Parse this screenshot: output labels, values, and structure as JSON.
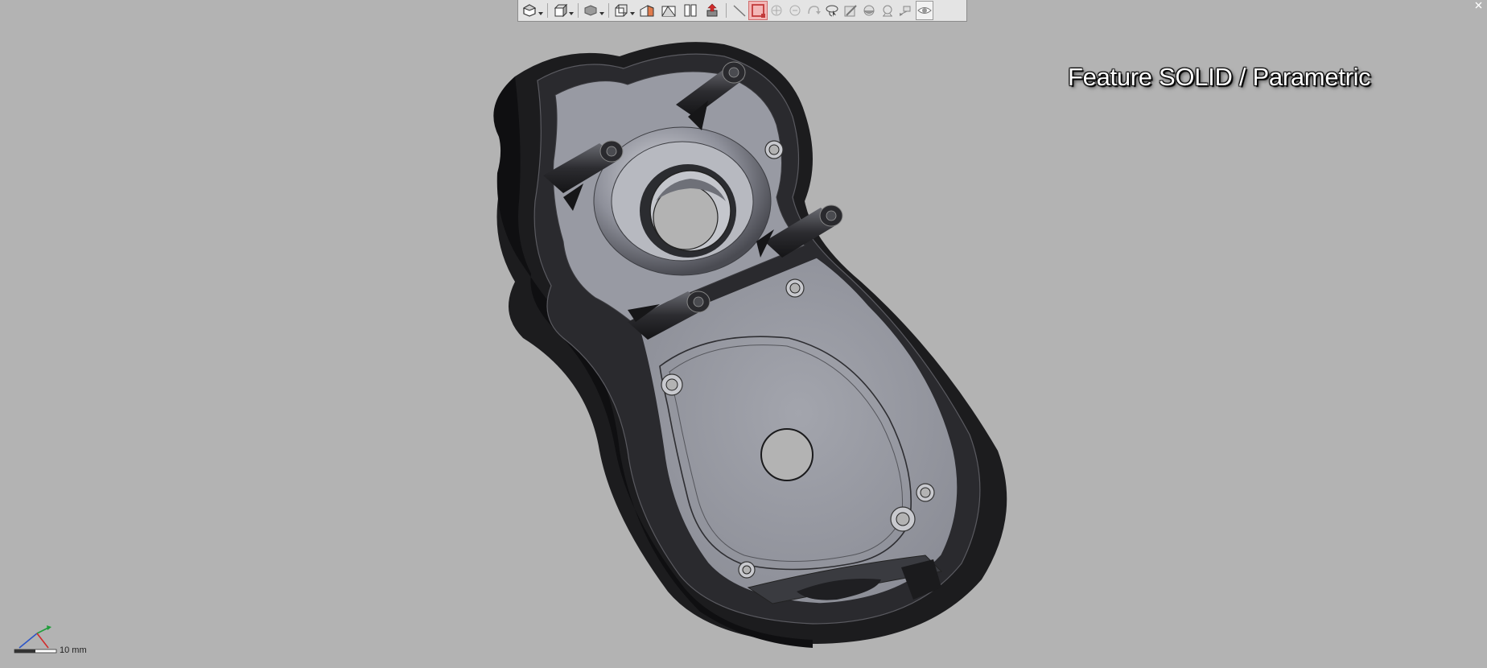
{
  "viewport": {
    "background": "#b3b3b3",
    "watermark_text": "Feature SOLID / Parametric",
    "scale_label": "10 mm"
  },
  "toolbar": {
    "buttons": [
      {
        "name": "zoom-to-fit",
        "icon": "zoom-fit-icon",
        "dropdown": true
      },
      {
        "name": "view-orientation",
        "icon": "view-cube-icon",
        "dropdown": true
      },
      {
        "name": "display-style",
        "icon": "shaded-edges-icon",
        "dropdown": true
      },
      {
        "name": "standard-views",
        "icon": "standard-views-icon",
        "dropdown": true
      },
      {
        "name": "section-view",
        "icon": "section-view-icon"
      },
      {
        "name": "previous-view",
        "icon": "previous-view-icon"
      },
      {
        "name": "split-view",
        "icon": "split-view-icon"
      },
      {
        "name": "hide-show",
        "icon": "hide-show-icon"
      },
      {
        "name": "line-tool",
        "icon": "line-icon"
      },
      {
        "name": "select-box",
        "icon": "box-select-icon",
        "active": true
      },
      {
        "name": "pan",
        "icon": "pan-icon"
      },
      {
        "name": "zoom",
        "icon": "zoom-icon"
      },
      {
        "name": "rotate",
        "icon": "rotate-icon"
      },
      {
        "name": "lasso",
        "icon": "lasso-icon"
      },
      {
        "name": "edit-appearance",
        "icon": "appearance-icon"
      },
      {
        "name": "apply-scene",
        "icon": "scene-icon"
      },
      {
        "name": "view-settings",
        "icon": "view-settings-icon"
      },
      {
        "name": "camera",
        "icon": "camera-icon"
      },
      {
        "name": "visibility",
        "icon": "eye-icon"
      }
    ],
    "accent_color": "#d06c6c"
  },
  "triad": {
    "axis_y_color": "#1f9e3a",
    "axis_x_color": "#d12b2b",
    "axis_z_color": "#2b55c7"
  }
}
